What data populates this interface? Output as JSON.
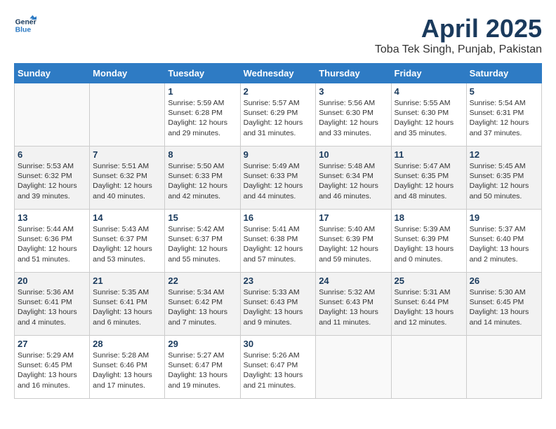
{
  "header": {
    "logo_line1": "General",
    "logo_line2": "Blue",
    "month_title": "April 2025",
    "location": "Toba Tek Singh, Punjab, Pakistan"
  },
  "weekdays": [
    "Sunday",
    "Monday",
    "Tuesday",
    "Wednesday",
    "Thursday",
    "Friday",
    "Saturday"
  ],
  "weeks": [
    [
      {
        "day": "",
        "info": ""
      },
      {
        "day": "",
        "info": ""
      },
      {
        "day": "1",
        "info": "Sunrise: 5:59 AM\nSunset: 6:28 PM\nDaylight: 12 hours\nand 29 minutes."
      },
      {
        "day": "2",
        "info": "Sunrise: 5:57 AM\nSunset: 6:29 PM\nDaylight: 12 hours\nand 31 minutes."
      },
      {
        "day": "3",
        "info": "Sunrise: 5:56 AM\nSunset: 6:30 PM\nDaylight: 12 hours\nand 33 minutes."
      },
      {
        "day": "4",
        "info": "Sunrise: 5:55 AM\nSunset: 6:30 PM\nDaylight: 12 hours\nand 35 minutes."
      },
      {
        "day": "5",
        "info": "Sunrise: 5:54 AM\nSunset: 6:31 PM\nDaylight: 12 hours\nand 37 minutes."
      }
    ],
    [
      {
        "day": "6",
        "info": "Sunrise: 5:53 AM\nSunset: 6:32 PM\nDaylight: 12 hours\nand 39 minutes."
      },
      {
        "day": "7",
        "info": "Sunrise: 5:51 AM\nSunset: 6:32 PM\nDaylight: 12 hours\nand 40 minutes."
      },
      {
        "day": "8",
        "info": "Sunrise: 5:50 AM\nSunset: 6:33 PM\nDaylight: 12 hours\nand 42 minutes."
      },
      {
        "day": "9",
        "info": "Sunrise: 5:49 AM\nSunset: 6:33 PM\nDaylight: 12 hours\nand 44 minutes."
      },
      {
        "day": "10",
        "info": "Sunrise: 5:48 AM\nSunset: 6:34 PM\nDaylight: 12 hours\nand 46 minutes."
      },
      {
        "day": "11",
        "info": "Sunrise: 5:47 AM\nSunset: 6:35 PM\nDaylight: 12 hours\nand 48 minutes."
      },
      {
        "day": "12",
        "info": "Sunrise: 5:45 AM\nSunset: 6:35 PM\nDaylight: 12 hours\nand 50 minutes."
      }
    ],
    [
      {
        "day": "13",
        "info": "Sunrise: 5:44 AM\nSunset: 6:36 PM\nDaylight: 12 hours\nand 51 minutes."
      },
      {
        "day": "14",
        "info": "Sunrise: 5:43 AM\nSunset: 6:37 PM\nDaylight: 12 hours\nand 53 minutes."
      },
      {
        "day": "15",
        "info": "Sunrise: 5:42 AM\nSunset: 6:37 PM\nDaylight: 12 hours\nand 55 minutes."
      },
      {
        "day": "16",
        "info": "Sunrise: 5:41 AM\nSunset: 6:38 PM\nDaylight: 12 hours\nand 57 minutes."
      },
      {
        "day": "17",
        "info": "Sunrise: 5:40 AM\nSunset: 6:39 PM\nDaylight: 12 hours\nand 59 minutes."
      },
      {
        "day": "18",
        "info": "Sunrise: 5:39 AM\nSunset: 6:39 PM\nDaylight: 13 hours\nand 0 minutes."
      },
      {
        "day": "19",
        "info": "Sunrise: 5:37 AM\nSunset: 6:40 PM\nDaylight: 13 hours\nand 2 minutes."
      }
    ],
    [
      {
        "day": "20",
        "info": "Sunrise: 5:36 AM\nSunset: 6:41 PM\nDaylight: 13 hours\nand 4 minutes."
      },
      {
        "day": "21",
        "info": "Sunrise: 5:35 AM\nSunset: 6:41 PM\nDaylight: 13 hours\nand 6 minutes."
      },
      {
        "day": "22",
        "info": "Sunrise: 5:34 AM\nSunset: 6:42 PM\nDaylight: 13 hours\nand 7 minutes."
      },
      {
        "day": "23",
        "info": "Sunrise: 5:33 AM\nSunset: 6:43 PM\nDaylight: 13 hours\nand 9 minutes."
      },
      {
        "day": "24",
        "info": "Sunrise: 5:32 AM\nSunset: 6:43 PM\nDaylight: 13 hours\nand 11 minutes."
      },
      {
        "day": "25",
        "info": "Sunrise: 5:31 AM\nSunset: 6:44 PM\nDaylight: 13 hours\nand 12 minutes."
      },
      {
        "day": "26",
        "info": "Sunrise: 5:30 AM\nSunset: 6:45 PM\nDaylight: 13 hours\nand 14 minutes."
      }
    ],
    [
      {
        "day": "27",
        "info": "Sunrise: 5:29 AM\nSunset: 6:45 PM\nDaylight: 13 hours\nand 16 minutes."
      },
      {
        "day": "28",
        "info": "Sunrise: 5:28 AM\nSunset: 6:46 PM\nDaylight: 13 hours\nand 17 minutes."
      },
      {
        "day": "29",
        "info": "Sunrise: 5:27 AM\nSunset: 6:47 PM\nDaylight: 13 hours\nand 19 minutes."
      },
      {
        "day": "30",
        "info": "Sunrise: 5:26 AM\nSunset: 6:47 PM\nDaylight: 13 hours\nand 21 minutes."
      },
      {
        "day": "",
        "info": ""
      },
      {
        "day": "",
        "info": ""
      },
      {
        "day": "",
        "info": ""
      }
    ]
  ]
}
